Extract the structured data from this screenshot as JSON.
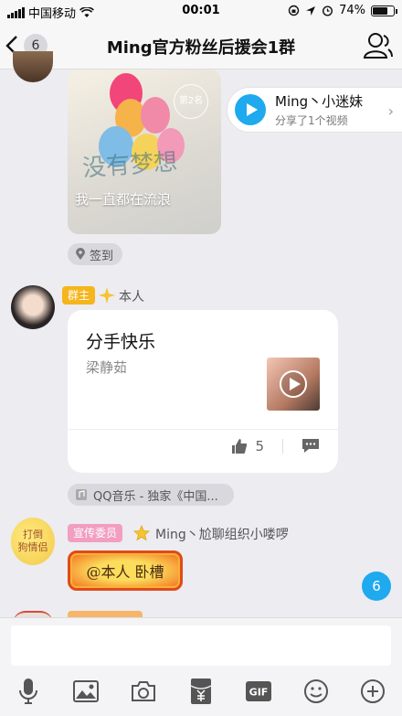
{
  "status_bar": {
    "carrier": "中国移动",
    "time": "00:01",
    "battery": "74%",
    "battery_level": 0.74
  },
  "nav": {
    "back_count": "6",
    "title": "Ming官方粉丝后援会1群"
  },
  "checkin": {
    "rank": "第2名",
    "overlay_text": "我一直都在流浪",
    "script_text": "没有梦想",
    "tag": "签到"
  },
  "share": {
    "name": "Ming丶小迷妹",
    "subtitle": "分享了1个视频"
  },
  "message2": {
    "role": "群主",
    "sender": "本人"
  },
  "music": {
    "title": "分手快乐",
    "artist": "梁静茹",
    "likes": "5",
    "source": "QQ音乐 - 独家《中国..."
  },
  "message3": {
    "ribbon_line1": "打倒",
    "ribbon_line2": "狗情侣",
    "role": "宣传委员",
    "sender": "Ming丶尬聊组织小喽啰",
    "mention": "@本人 卧槽"
  },
  "unread_count": "6",
  "input": {
    "placeholder": ""
  },
  "toolbar": {
    "gif_label": "GIF"
  },
  "colors": {
    "accent": "#1fa9ee",
    "owner_badge": "#f5b51c",
    "publicity_badge": "#f19ec2"
  },
  "icons": [
    "chevron-left-icon",
    "profile-icon",
    "location-pin-icon",
    "play-icon",
    "chevron-right-icon",
    "diamond-icon",
    "like-icon",
    "comment-icon",
    "music-note-icon",
    "star-icon",
    "microphone-icon",
    "image-icon",
    "camera-icon",
    "red-packet-icon",
    "gif-icon",
    "emoji-icon",
    "plus-icon"
  ]
}
